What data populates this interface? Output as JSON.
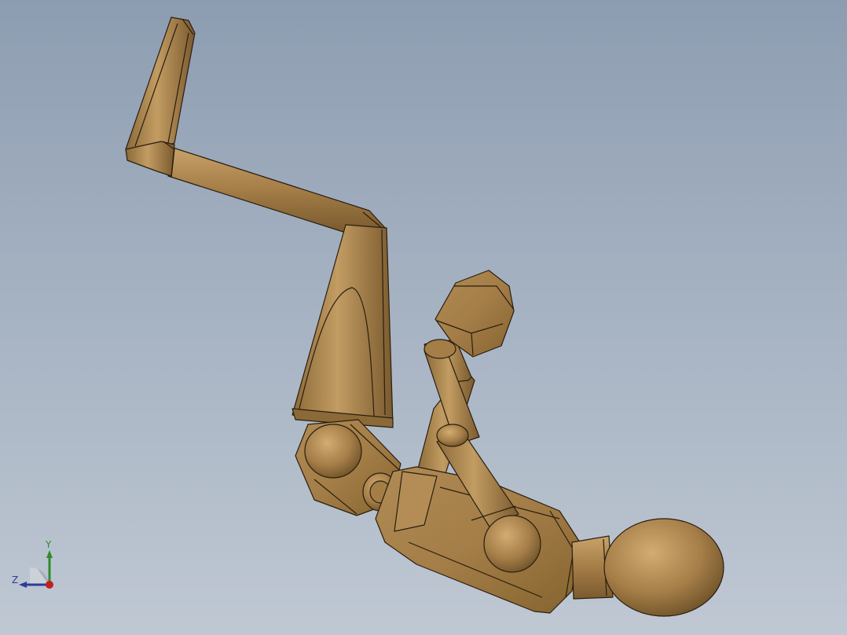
{
  "viewport": {
    "background_top": "#8d9db1",
    "background_bottom": "#bfc8d3"
  },
  "model": {
    "name": "wooden-mannequin-figure",
    "body_color": "#a47d47",
    "edge_color": "#2a1e10"
  },
  "triad": {
    "y_label": "Y",
    "z_label": "Z",
    "y_color": "#2e8b2e",
    "z_color": "#2b3d9a",
    "x_color": "#c41e1e"
  }
}
